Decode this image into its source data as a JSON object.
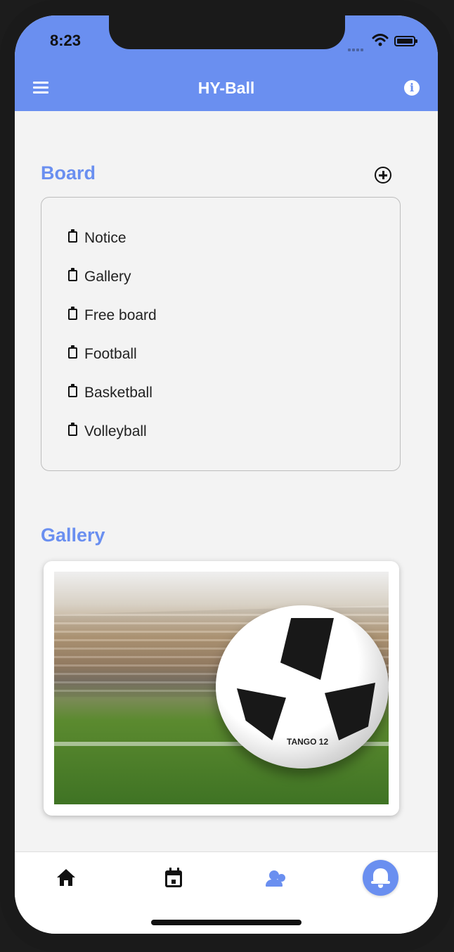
{
  "status_bar": {
    "time": "8:23"
  },
  "app_bar": {
    "title": "HY-Ball",
    "menu_icon": "menu-icon",
    "info_icon": "info-icon"
  },
  "board": {
    "title": "Board",
    "add_icon": "add-circle-icon",
    "items": [
      {
        "label": "Notice",
        "icon": "clipboard-icon"
      },
      {
        "label": "Gallery",
        "icon": "clipboard-icon"
      },
      {
        "label": "Free board",
        "icon": "clipboard-icon"
      },
      {
        "label": "Football",
        "icon": "clipboard-icon"
      },
      {
        "label": "Basketball",
        "icon": "clipboard-icon"
      },
      {
        "label": "Volleyball",
        "icon": "clipboard-icon"
      }
    ]
  },
  "gallery": {
    "title": "Gallery",
    "image_icon": "soccer-ball-stadium-photo",
    "ball_text": "TANGO 12"
  },
  "bottom_nav": {
    "items": [
      {
        "icon": "home-icon",
        "active": false
      },
      {
        "icon": "calendar-icon",
        "active": false
      },
      {
        "icon": "group-icon",
        "active": true
      },
      {
        "icon": "bell-icon",
        "active": true
      }
    ]
  },
  "colors": {
    "primary": "#6a8ff0",
    "background": "#f3f3f3",
    "text": "#222222",
    "border": "#bdbdbd"
  }
}
